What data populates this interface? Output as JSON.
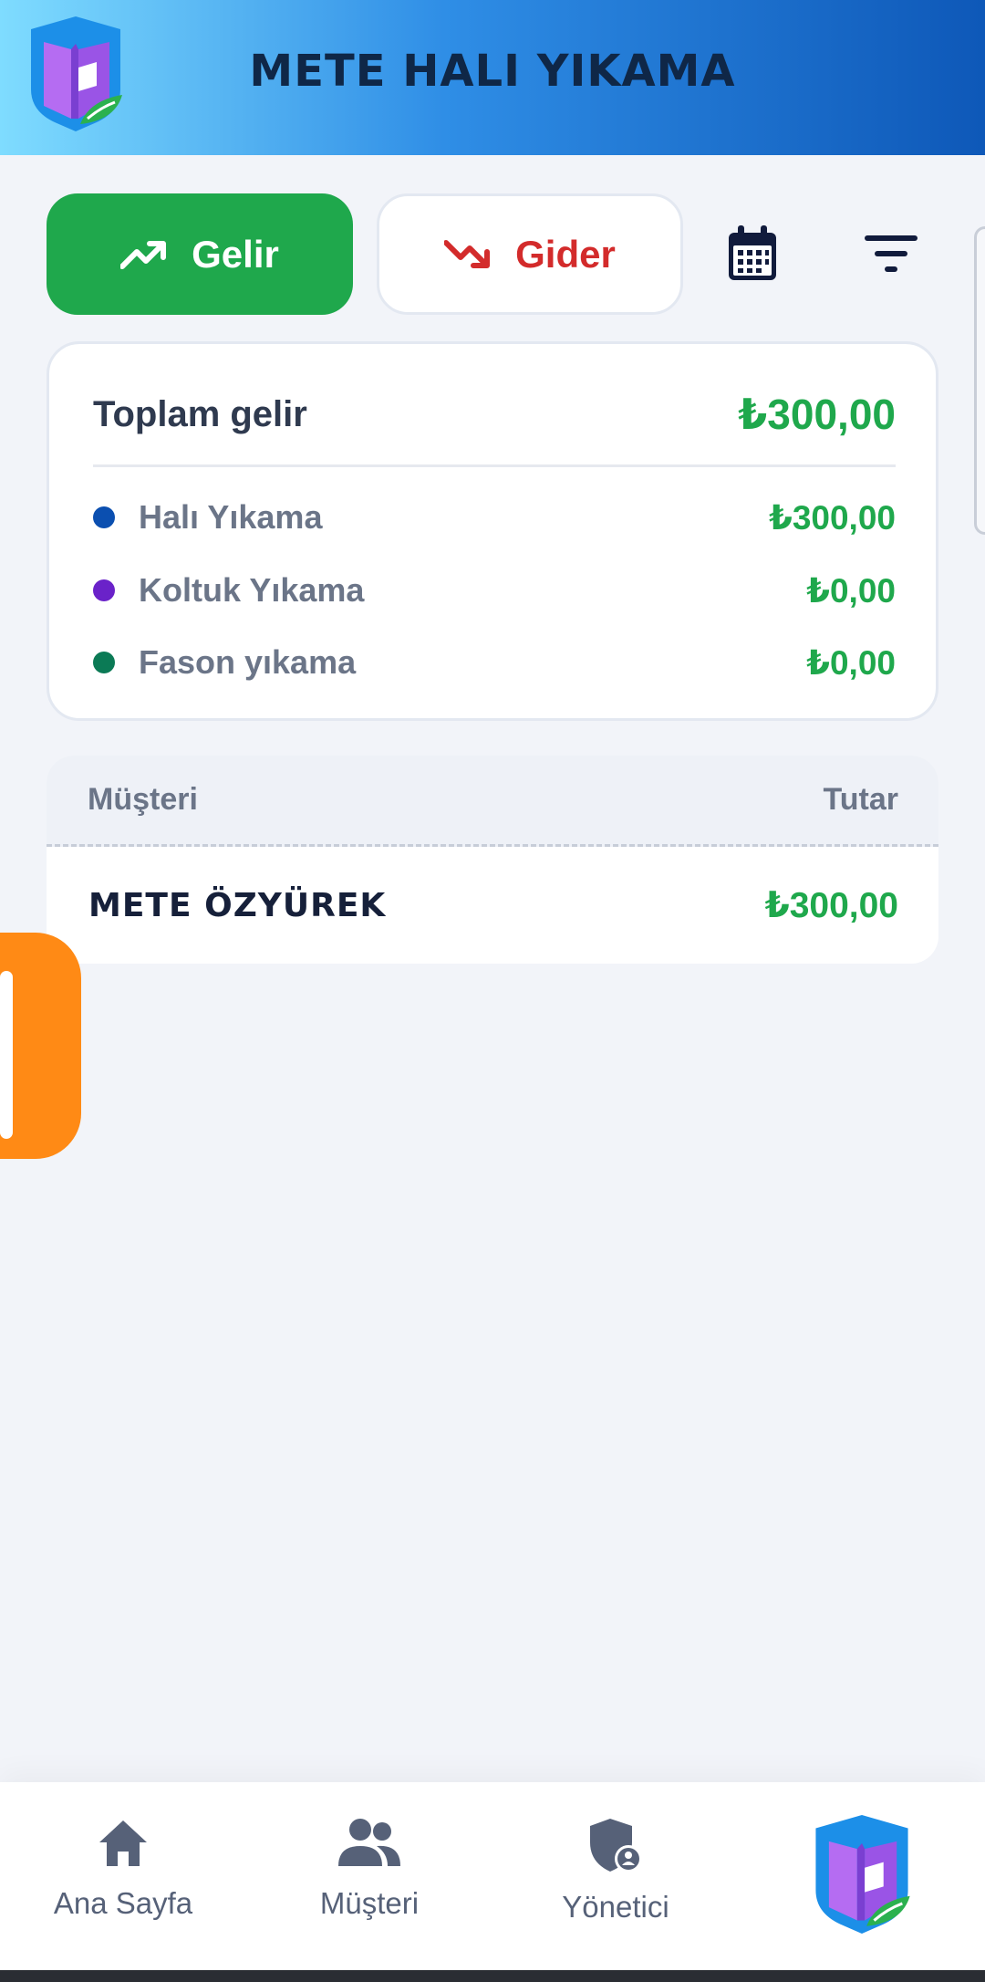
{
  "app": {
    "title": "METE HALI YIKAMA",
    "logo": "mete-logo"
  },
  "colors": {
    "income": "#1fa84c",
    "expense": "#d32b2b",
    "accent": "#ff8a15",
    "header_start": "#7fdcff",
    "header_end": "#0e58b8"
  },
  "toolbar": {
    "income_label": "Gelir",
    "income_icon": "trending-up-icon",
    "expense_label": "Gider",
    "expense_icon": "trending-down-icon",
    "calendar_icon": "calendar-icon",
    "filter_icon": "filter-icon"
  },
  "summary": {
    "total_label": "Toplam gelir",
    "total_value": "₺300,00",
    "categories": [
      {
        "label": "Halı Yıkama",
        "value": "₺300,00",
        "color": "#0b4fb0"
      },
      {
        "label": "Koltuk Yıkama",
        "value": "₺0,00",
        "color": "#6a22c9"
      },
      {
        "label": "Fason yıkama",
        "value": "₺0,00",
        "color": "#0b7a55"
      }
    ]
  },
  "table": {
    "columns": [
      "Müşteri",
      "Tutar"
    ],
    "rows": [
      {
        "customer": "METE ÖZYÜREK",
        "amount": "₺300,00"
      }
    ]
  },
  "nav": {
    "items": [
      {
        "label": "Ana Sayfa",
        "icon": "home-icon"
      },
      {
        "label": "Müşteri",
        "icon": "users-icon"
      },
      {
        "label": "Yönetici",
        "icon": "admin-shield-icon"
      }
    ]
  }
}
